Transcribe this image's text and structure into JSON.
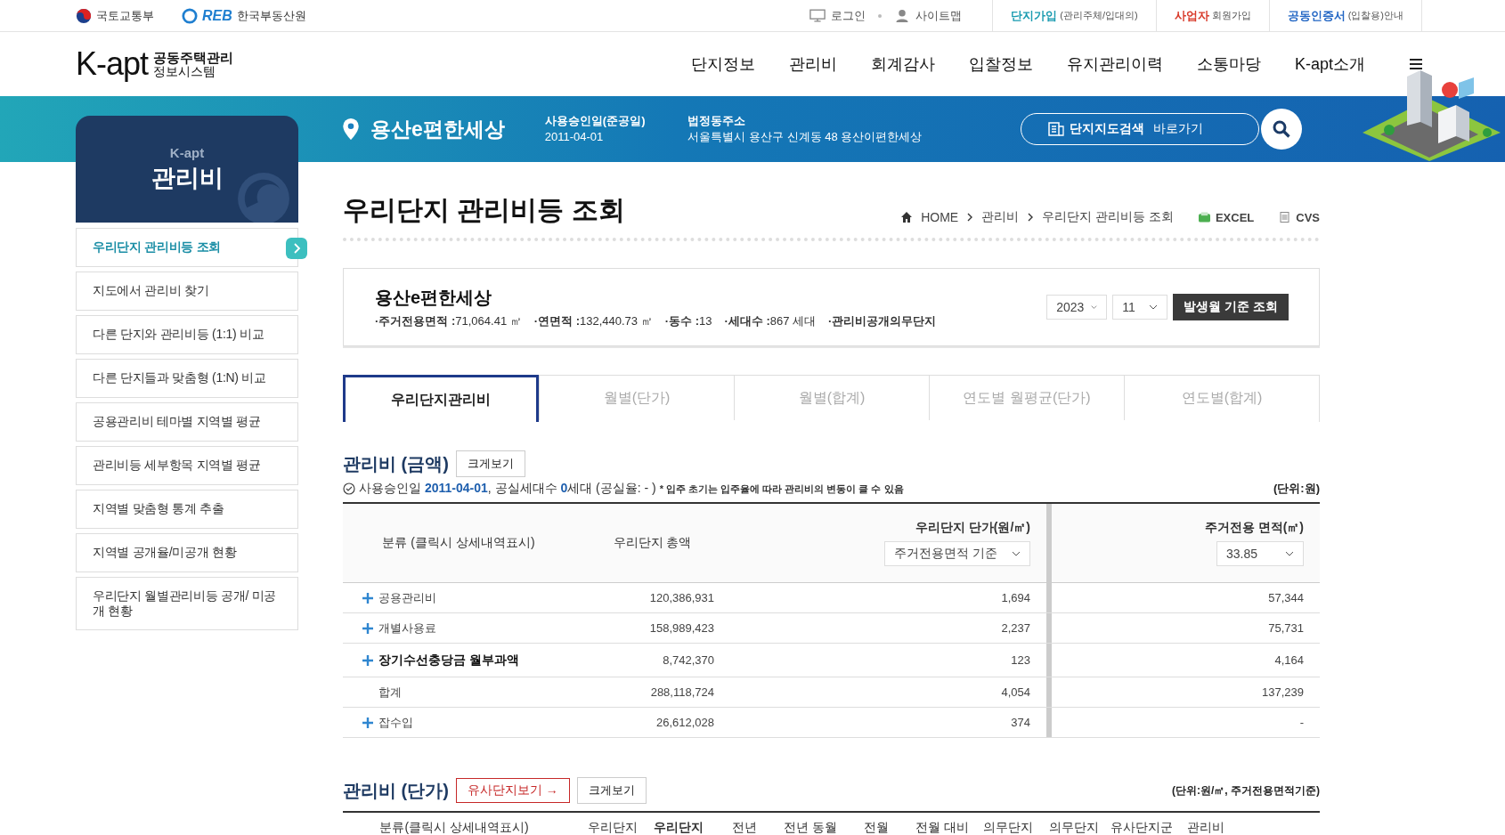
{
  "top_bar": {
    "agencies": [
      "국토교통부",
      "한국부동산원"
    ],
    "reb_logo": "REB",
    "links": [
      "로그인",
      "사이트맵"
    ],
    "join_links": [
      {
        "strong": "단지가입",
        "rest": "(관리주체/입대의)",
        "color": "#1a9bb0"
      },
      {
        "strong": "사업자",
        "rest": "회원가입",
        "color": "#d83a2a"
      },
      {
        "strong": "공동인증서",
        "rest": "(입찰용)안내",
        "color": "#2266c4"
      }
    ]
  },
  "header": {
    "logo": "K-apt",
    "logo_sub": [
      "공동주택관리",
      "정보시스템"
    ],
    "nav": [
      "단지정보",
      "관리비",
      "회계감사",
      "입찰정보",
      "유지관리이력",
      "소통마당",
      "K-apt소개"
    ]
  },
  "complex_band": {
    "name": "용산e편한세상",
    "approval_label": "사용승인일(준공일)",
    "approval_date": "2011-04-01",
    "address_label": "법정동주소",
    "address": "서울특별시 용산구 신계동 48 용산이편한세상",
    "map_search": {
      "strong": "단지지도검색",
      "rest": "바로가기"
    }
  },
  "sidebar": {
    "brand": "K-apt",
    "title": "관리비",
    "items": [
      {
        "label": "우리단지 관리비등 조회",
        "selected": true
      },
      {
        "label": "지도에서 관리비 찾기",
        "selected": false
      },
      {
        "label": "다른 단지와 관리비등 (1:1) 비교",
        "selected": false
      },
      {
        "label": "다른 단지들과 맞춤형 (1:N) 비교",
        "selected": false
      },
      {
        "label": "공용관리비 테마별 지역별 평균",
        "selected": false
      },
      {
        "label": "관리비등 세부항목 지역별 평균",
        "selected": false
      },
      {
        "label": "지역별 맞춤형 통계 추출",
        "selected": false
      },
      {
        "label": "지역별 공개율/미공개 현황",
        "selected": false
      },
      {
        "label": "우리단지 월별관리비등 공개/ 미공개 현황",
        "selected": false
      }
    ]
  },
  "page": {
    "title": "우리단지 관리비등 조회",
    "breadcrumb": [
      "HOME",
      "관리비",
      "우리단지 관리비등 조회"
    ],
    "exports": [
      "EXCEL",
      "CVS"
    ]
  },
  "info_box": {
    "name": "용산e편한세상",
    "facts": [
      {
        "label": "·주거전용면적 :",
        "value": "71,064.41 ㎡"
      },
      {
        "label": "·연면적 :",
        "value": "132,440.73 ㎡"
      },
      {
        "label": "·동수 :",
        "value": "13"
      },
      {
        "label": "·세대수 :",
        "value": "867 세대"
      },
      {
        "label": "·관리비공개의무단지"
      }
    ],
    "year": "2023",
    "month": "11",
    "query_button": "발생월 기준 조회"
  },
  "tabs": [
    {
      "label": "우리단지관리비",
      "selected": true
    },
    {
      "label": "월별(단가)",
      "selected": false
    },
    {
      "label": "월별(합계)",
      "selected": false
    },
    {
      "label": "연도별 월평균(단가)",
      "selected": false
    },
    {
      "label": "연도별(합계)",
      "selected": false
    }
  ],
  "amount_section": {
    "title": "관리비 (금액)",
    "zoom_button": "크게보기",
    "note": "사용승인일 **2011-04-01**, 공실세대수 **0**세대 (공실율: - )",
    "warning": "* 입주 초기는 입주율에 따라 관리비의 변동이 클 수 있음",
    "unit": "(단위:원)",
    "columns": [
      "분류 (클릭시 상세내역표시)",
      "우리단지 총액",
      "우리단지 단가(원/㎡)",
      "주거전용 면적(㎡)"
    ],
    "unit_select": "주거전용면적 기준",
    "area_select": "33.85",
    "rows": [
      {
        "category": "공용관리비",
        "total": "120,386,931",
        "unit_price": "1,694",
        "by_area": "57,344",
        "expandable": true,
        "bold": false
      },
      {
        "category": "개별사용료",
        "total": "158,989,423",
        "unit_price": "2,237",
        "by_area": "75,731",
        "expandable": true,
        "bold": false
      },
      {
        "category": "장기수선충당금 월부과액",
        "total": "8,742,370",
        "unit_price": "123",
        "by_area": "4,164",
        "expandable": true,
        "bold": true
      },
      {
        "category": "합계",
        "total": "288,118,724",
        "unit_price": "4,054",
        "by_area": "137,239",
        "expandable": false,
        "bold": false
      },
      {
        "category": "잡수입",
        "total": "26,612,028",
        "unit_price": "374",
        "by_area": "-",
        "expandable": true,
        "bold": false
      }
    ]
  },
  "unit_section": {
    "title": "관리비 (단가)",
    "similar_button": "유사단지보기 →",
    "zoom_button": "크게보기",
    "unit": "(단위:원/㎡, 주거전용면적기준)",
    "columns": [
      {
        "label": "분류(클릭시 상세내역표시)",
        "bold": false
      },
      {
        "label": "우리단지",
        "bold": false
      },
      {
        "label": "우리단지",
        "bold": true
      },
      {
        "label": "전년",
        "bold": false
      },
      {
        "label": "전년 동월",
        "bold": false
      },
      {
        "label": "전월",
        "bold": false
      },
      {
        "label": "전월 대비",
        "bold": false
      },
      {
        "label": "의무단지",
        "bold": false
      },
      {
        "label": "의무단지",
        "bold": false
      },
      {
        "label": "유사단지군",
        "bold": false
      },
      {
        "label": "관리비",
        "bold": false
      }
    ]
  }
}
